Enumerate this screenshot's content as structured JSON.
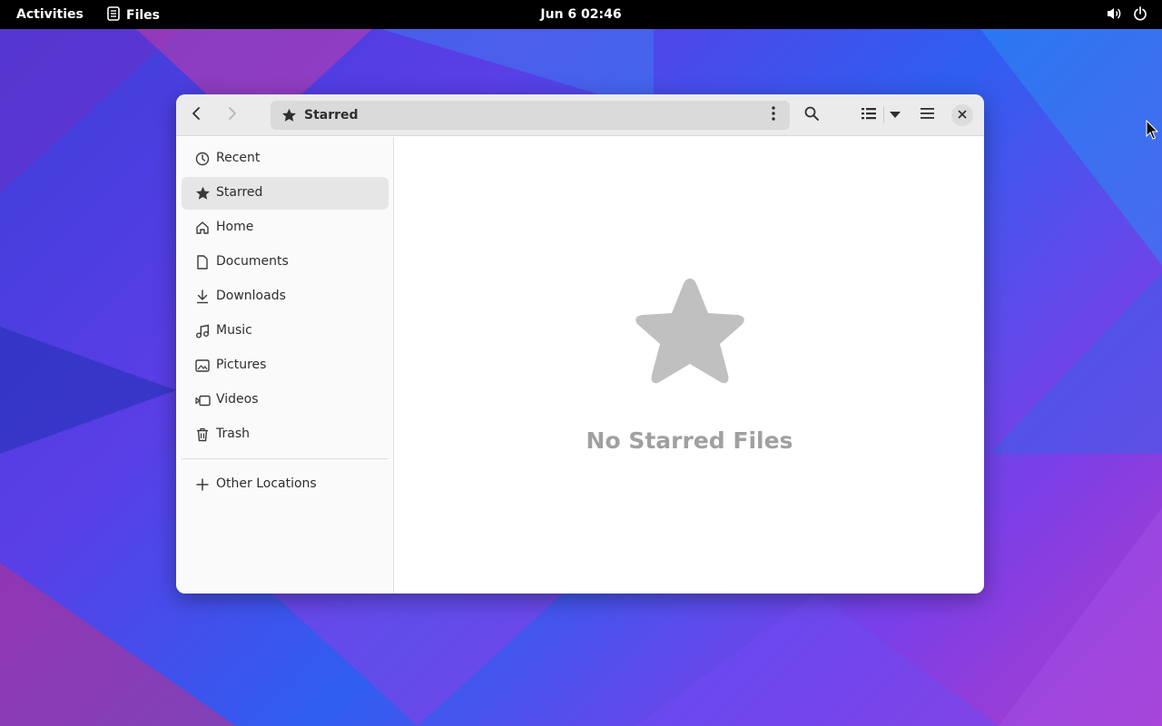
{
  "topbar": {
    "activities": "Activities",
    "app_name": "Files",
    "clock": "Jun 6  02:46",
    "volume_icon": "speaker-icon",
    "power_icon": "power-icon"
  },
  "window": {
    "path_label": "Starred",
    "icons": {
      "back": "chevron-left-icon",
      "forward": "chevron-right-icon",
      "search": "search-icon",
      "view": "list-view-icon",
      "view_options": "chevron-down-icon",
      "menu": "hamburger-menu-icon",
      "close": "close-icon"
    }
  },
  "sidebar": {
    "items": [
      {
        "label": "Recent",
        "icon": "clock-icon"
      },
      {
        "label": "Starred",
        "icon": "star-icon",
        "active": true
      },
      {
        "label": "Home",
        "icon": "home-icon"
      },
      {
        "label": "Documents",
        "icon": "document-icon"
      },
      {
        "label": "Downloads",
        "icon": "download-icon"
      },
      {
        "label": "Music",
        "icon": "music-icon"
      },
      {
        "label": "Pictures",
        "icon": "image-icon"
      },
      {
        "label": "Videos",
        "icon": "video-icon"
      },
      {
        "label": "Trash",
        "icon": "trash-icon"
      }
    ],
    "other_locations": "Other Locations"
  },
  "main": {
    "empty_title": "No Starred Files"
  },
  "colors": {
    "topbar": "#000000",
    "headerbar": "#ebebeb",
    "sidebar": "#fafafa",
    "active_item": "#e6e6e6",
    "empty_placeholder": "#a0a0a0"
  }
}
